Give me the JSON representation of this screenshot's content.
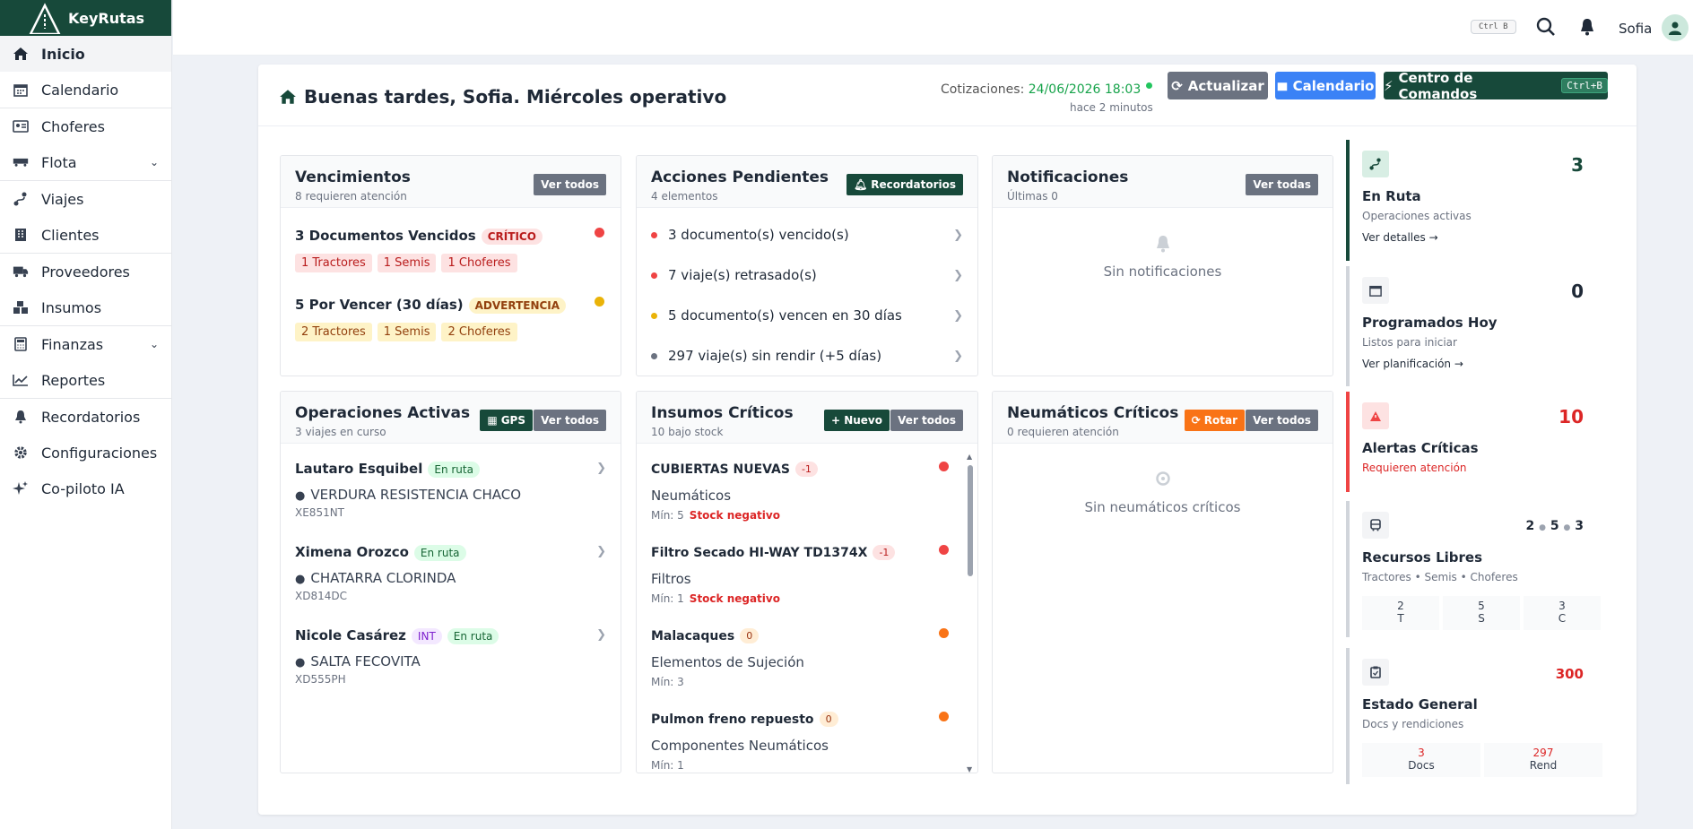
{
  "app": {
    "name": "KeyRutas"
  },
  "sidebar": {
    "items": [
      {
        "label": "Inicio",
        "icon": "home-icon",
        "active": true
      },
      {
        "label": "Calendario",
        "icon": "calendar-icon"
      },
      {
        "label": "Choferes",
        "icon": "id-card-icon"
      },
      {
        "label": "Flota",
        "icon": "truck-icon",
        "expandable": true
      },
      {
        "label": "Viajes",
        "icon": "route-icon"
      },
      {
        "label": "Clientes",
        "icon": "building-icon"
      },
      {
        "label": "Proveedores",
        "icon": "delivery-truck-icon"
      },
      {
        "label": "Insumos",
        "icon": "boxes-icon"
      },
      {
        "label": "Finanzas",
        "icon": "calculator-icon",
        "expandable": true
      },
      {
        "label": "Reportes",
        "icon": "chart-line-icon"
      },
      {
        "label": "Recordatorios",
        "icon": "bell-icon"
      },
      {
        "label": "Configuraciones",
        "icon": "gear-icon"
      },
      {
        "label": "Co-piloto IA",
        "icon": "sparkles-icon"
      }
    ]
  },
  "topbar": {
    "shortcut": "Ctrl B",
    "user": "Sofia"
  },
  "header": {
    "greeting": "Buenas tardes, Sofia. Miércoles operativo",
    "quote_label": "Cotizaciones:",
    "quote_date": "24/06/2026 18:03",
    "quote_ago": "hace 2 minutos",
    "btn_refresh": "Actualizar",
    "btn_calendar": "Calendario",
    "btn_command": "Centro de Comandos",
    "btn_command_kbd": "Ctrl+B"
  },
  "vencimientos": {
    "title": "Vencimientos",
    "subtitle": "8 requieren atención",
    "btn": "Ver todos",
    "groups": [
      {
        "label": "3 Documentos Vencidos",
        "tag": "CRÍTICO",
        "chips": [
          "1 Tractores",
          "1 Semis",
          "1 Choferes"
        ],
        "color": "#ef4444"
      },
      {
        "label": "5 Por Vencer (30 días)",
        "tag": "ADVERTENCIA",
        "chips": [
          "2 Tractores",
          "1 Semis",
          "2 Choferes"
        ],
        "color": "#eab308"
      }
    ]
  },
  "acciones": {
    "title": "Acciones Pendientes",
    "subtitle": "4 elementos",
    "btn": "Recordatorios",
    "items": [
      {
        "label": "3 documento(s) vencido(s)",
        "color": "#ef4444"
      },
      {
        "label": "7 viaje(s) retrasado(s)",
        "color": "#ef4444"
      },
      {
        "label": "5 documento(s) vencen en 30 días",
        "color": "#eab308"
      },
      {
        "label": "297 viaje(s) sin rendir (+5 días)",
        "color": "#6b7280"
      }
    ]
  },
  "notificaciones": {
    "title": "Notificaciones",
    "subtitle": "Últimas 0",
    "btn": "Ver todas",
    "empty": "Sin notificaciones"
  },
  "operaciones": {
    "title": "Operaciones Activas",
    "subtitle": "3 viajes en curso",
    "btn_gps": "GPS",
    "btn": "Ver todos",
    "items": [
      {
        "name": "Lautaro Esquibel",
        "tags": [
          {
            "label": "En ruta",
            "type": "green"
          }
        ],
        "loc": "VERDURA RESISTENCIA CHACO",
        "plate": "XE851NT"
      },
      {
        "name": "Ximena Orozco",
        "tags": [
          {
            "label": "En ruta",
            "type": "green"
          }
        ],
        "loc": "CHATARRA CLORINDA",
        "plate": "XD814DC"
      },
      {
        "name": "Nicole Casárez",
        "tags": [
          {
            "label": "INT",
            "type": "purple"
          },
          {
            "label": "En ruta",
            "type": "green"
          }
        ],
        "loc": "SALTA FECOVITA",
        "plate": "XD555PH"
      }
    ]
  },
  "insumos": {
    "title": "Insumos Críticos",
    "subtitle": "10 bajo stock",
    "btn_new": "+ Nuevo",
    "btn": "Ver todos",
    "items": [
      {
        "name": "CUBIERTAS NUEVAS",
        "badge": "-1",
        "type": "neg",
        "cat": "Neumáticos",
        "min": "Mín: 5",
        "warn": "Stock negativo",
        "color": "#ef4444"
      },
      {
        "name": "Filtro Secado HI-WAY TD1374X",
        "badge": "-1",
        "type": "neg",
        "cat": "Filtros",
        "min": "Mín: 1",
        "warn": "Stock negativo",
        "color": "#ef4444"
      },
      {
        "name": "Malacaques",
        "badge": "0",
        "type": "zero",
        "cat": "Elementos de Sujeción",
        "min": "Mín: 3",
        "warn": "",
        "color": "#f97316"
      },
      {
        "name": "Pulmon freno repuesto",
        "badge": "0",
        "type": "zero",
        "cat": "Componentes Neumáticos",
        "min": "Mín: 1",
        "warn": "",
        "color": "#f97316"
      }
    ]
  },
  "neumaticos": {
    "title": "Neumáticos Críticos",
    "subtitle": "0 requieren atención",
    "btn_rotate": "Rotar",
    "btn": "Ver todos",
    "empty": "Sin neumáticos críticos"
  },
  "stats": {
    "en_ruta": {
      "num": "3",
      "title": "En Ruta",
      "sub": "Operaciones activas",
      "link": "Ver detalles →",
      "color": "#17493a"
    },
    "programados": {
      "num": "0",
      "title": "Programados Hoy",
      "sub": "Listos para iniciar",
      "link": "Ver planificación →",
      "color": "#1f2937"
    },
    "alertas": {
      "num": "10",
      "title": "Alertas Críticas",
      "sub": "Requieren atención",
      "color": "#dc2626"
    },
    "recursos": {
      "num_t": "2",
      "num_s": "5",
      "num_c": "3",
      "title": "Recursos Libres",
      "sub": "Tractores • Semis • Choferes",
      "boxes": [
        {
          "v": "2",
          "l": "T"
        },
        {
          "v": "5",
          "l": "S"
        },
        {
          "v": "3",
          "l": "C"
        }
      ]
    },
    "estado": {
      "num": "300",
      "title": "Estado General",
      "sub": "Docs y rendiciones",
      "boxes": [
        {
          "v": "3",
          "l": "Docs"
        },
        {
          "v": "297",
          "l": "Rend"
        }
      ],
      "color": "#dc2626"
    }
  }
}
